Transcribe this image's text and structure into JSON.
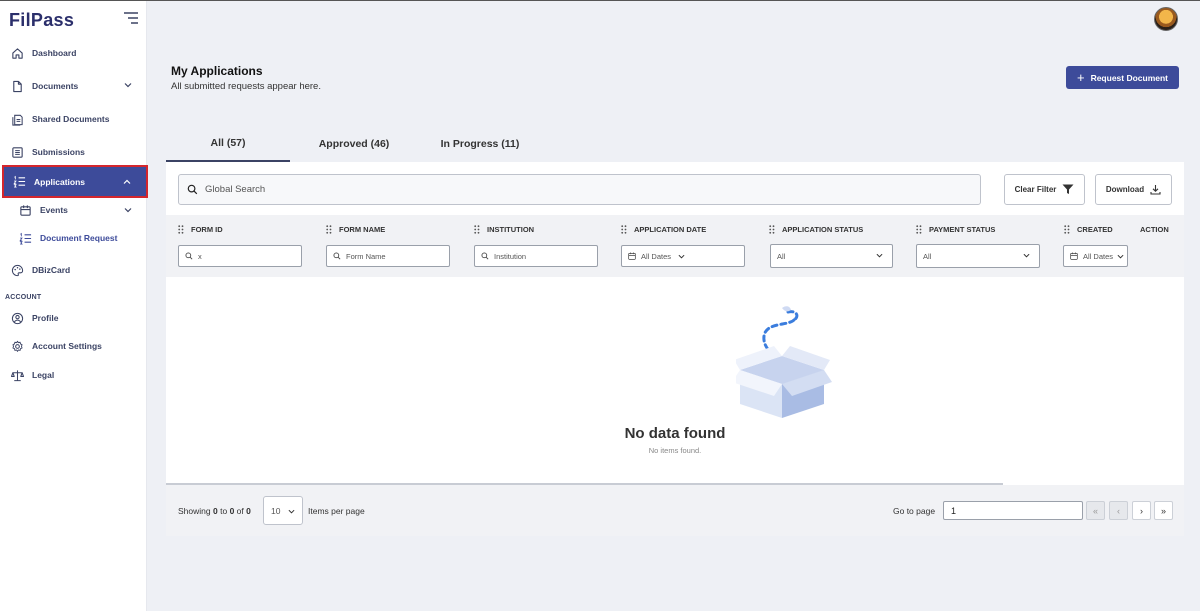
{
  "app": {
    "logo_text": "FilPass"
  },
  "sidebar": {
    "items": [
      {
        "label": "Dashboard",
        "icon": "home-icon"
      },
      {
        "label": "Documents",
        "icon": "document-icon"
      },
      {
        "label": "Shared Documents",
        "icon": "shared-documents-icon"
      },
      {
        "label": "Submissions",
        "icon": "submissions-icon"
      },
      {
        "label": "Applications",
        "icon": "list-icon"
      },
      {
        "label": "Events",
        "icon": "calendar-icon"
      },
      {
        "label": "Document Request",
        "icon": "list-icon"
      },
      {
        "label": "DBizCard",
        "icon": "palette-icon"
      }
    ],
    "section_account": "ACCOUNT",
    "account_items": [
      {
        "label": "Profile",
        "icon": "user-icon"
      },
      {
        "label": "Account Settings",
        "icon": "gear-icon"
      },
      {
        "label": "Legal",
        "icon": "scale-icon"
      }
    ]
  },
  "header": {
    "title": "My Applications",
    "subtitle": "All submitted requests appear here.",
    "request_button": "Request Document"
  },
  "tabs": [
    {
      "label": "All (57)",
      "active": true
    },
    {
      "label": "Approved (46)",
      "active": false
    },
    {
      "label": "In Progress (11)",
      "active": false
    }
  ],
  "toolbar": {
    "search_placeholder": "Global Search",
    "clear_filter": "Clear Filter",
    "download": "Download"
  },
  "table": {
    "columns": [
      {
        "header": "FORM ID",
        "filter_value": "x",
        "filter_type": "search"
      },
      {
        "header": "FORM NAME",
        "filter_value": "Form Name",
        "filter_type": "search"
      },
      {
        "header": "INSTITUTION",
        "filter_value": "Institution",
        "filter_type": "search"
      },
      {
        "header": "APPLICATION DATE",
        "filter_value": "All Dates",
        "filter_type": "date"
      },
      {
        "header": "APPLICATION STATUS",
        "filter_value": "All",
        "filter_type": "select"
      },
      {
        "header": "PAYMENT STATUS",
        "filter_value": "All",
        "filter_type": "select"
      },
      {
        "header": "CREATED",
        "filter_value": "All Dates",
        "filter_type": "date"
      },
      {
        "header": "ACTION",
        "filter_value": "",
        "filter_type": "none"
      }
    ],
    "empty_title": "No data found",
    "empty_subtitle": "No items found."
  },
  "pagination": {
    "showing_prefix": "Showing",
    "from": "0",
    "to_word": "to",
    "to": "0",
    "of_word": "of",
    "total": "0",
    "per_page": "10",
    "per_page_label": "Items per page",
    "goto_label": "Go to page",
    "goto_value": "1",
    "first": "«",
    "prev": "‹",
    "next": "›",
    "last": "»"
  },
  "colors": {
    "primary": "#3d4b9a",
    "highlight_border": "#d4262d",
    "background": "#eef0f5"
  }
}
